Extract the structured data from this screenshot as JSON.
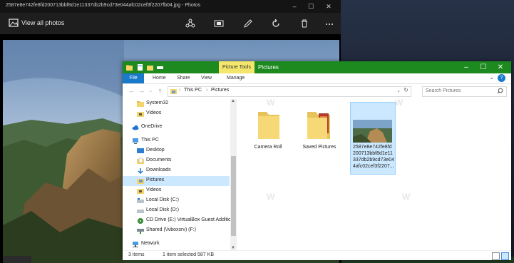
{
  "photos": {
    "title": "2587e8e742fe8fd200713bbf8d1e11337db2b9cd73e044afc02cef3f2207fb04.jpg - Photos",
    "view_all": "View all photos",
    "icons": [
      "share-icon",
      "slideshow-icon",
      "edit-icon",
      "rotate-icon",
      "delete-icon",
      "more-icon"
    ]
  },
  "explorer": {
    "context_tab": "Picture Tools",
    "title": "Pictures",
    "ribbon_tabs": [
      "File",
      "Home",
      "Share",
      "View",
      "Manage"
    ],
    "breadcrumb": [
      "This PC",
      "Pictures"
    ],
    "search_placeholder": "Search Pictures",
    "nav": [
      {
        "label": "System32",
        "icon": "folder-icon",
        "indent": 2
      },
      {
        "label": "Videos",
        "icon": "videos-folder-icon",
        "indent": 2
      },
      {
        "label": "OneDrive",
        "icon": "onedrive-icon",
        "indent": 1
      },
      {
        "label": "This PC",
        "icon": "pc-icon",
        "indent": 1
      },
      {
        "label": "Desktop",
        "icon": "desktop-icon",
        "indent": 2
      },
      {
        "label": "Documents",
        "icon": "documents-icon",
        "indent": 2
      },
      {
        "label": "Downloads",
        "icon": "downloads-icon",
        "indent": 2
      },
      {
        "label": "Pictures",
        "icon": "pictures-icon",
        "indent": 2,
        "selected": true
      },
      {
        "label": "Videos",
        "icon": "videos-folder-icon",
        "indent": 2
      },
      {
        "label": "Local Disk (C:)",
        "icon": "disk-icon",
        "indent": 2
      },
      {
        "label": "Local Disk (D:)",
        "icon": "disk-icon",
        "indent": 2
      },
      {
        "label": "CD Drive (E:) VirtualBox Guest Additions",
        "icon": "cd-icon",
        "indent": 2
      },
      {
        "label": "Shared (\\\\vboxsrv) (F:)",
        "icon": "network-drive-icon",
        "indent": 2
      },
      {
        "label": "Network",
        "icon": "network-icon",
        "indent": 1
      }
    ],
    "files": [
      {
        "label": "Camera Roll",
        "type": "folder"
      },
      {
        "label": "Saved Pictures",
        "type": "folder-photos"
      },
      {
        "label": "2587e8e742fe8fd200713bbf8d1e11337db2b9cd73e044afc02cef3f2207...",
        "type": "image",
        "selected": true
      }
    ],
    "status": {
      "items": "3 items",
      "selected": "1 item selected  587 KB"
    }
  },
  "colors": {
    "titlebar": "#1d8a1f",
    "context_tab": "#f3e66a",
    "selection": "#cce8ff",
    "file_tab": "#1979ca"
  }
}
